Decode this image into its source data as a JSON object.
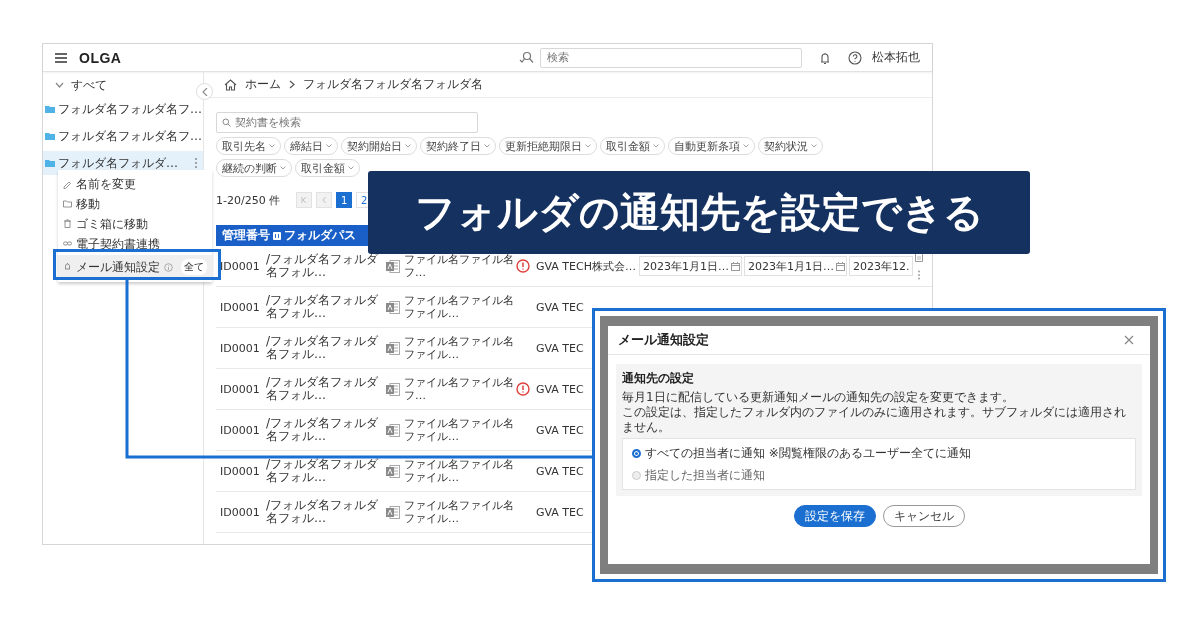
{
  "app": {
    "logo": "OLGA",
    "search_placeholder": "検索",
    "user_name": "松本拓也"
  },
  "sidebar": {
    "root": {
      "label": "すべて",
      "expanded": true
    },
    "folders": [
      {
        "label": "フォルダ名フォルダ名フ…",
        "selected": false
      },
      {
        "label": "フォルダ名フォルダ名フ…",
        "selected": false
      },
      {
        "label": "フォルダ名フォルダ…",
        "selected": true
      }
    ]
  },
  "context_menu": {
    "items": [
      {
        "kind": "rename",
        "label": "名前を変更",
        "selected": false
      },
      {
        "kind": "move",
        "label": "移動",
        "selected": false
      },
      {
        "kind": "trash",
        "label": "ゴミ箱に移動",
        "selected": false
      },
      {
        "kind": "link",
        "label": "電子契約書連携",
        "selected": false
      },
      {
        "kind": "notify",
        "label": "メール通知設定",
        "badge": "全て",
        "selected": true
      }
    ]
  },
  "breadcrumb": [
    "ホーム",
    "フォルダ名フォルダ名フォルダ名"
  ],
  "search": {
    "placeholder": "契約書を検索"
  },
  "filter_rows": [
    {
      "chips": [
        "取引先名",
        "締結日",
        "契約開始日",
        "契約終了日",
        "更新拒絶期限日",
        "取引金額",
        "自動更新条項",
        "契約状況"
      ]
    },
    {
      "chips": [
        "継続の判断",
        "取引金額"
      ]
    }
  ],
  "pagination": {
    "range": "1-20/250 件",
    "pages": [
      {
        "label": "1",
        "selected": true
      },
      {
        "label": "2",
        "selected": false
      }
    ]
  },
  "table": {
    "columns": [
      "管理番号",
      "フォルダパス"
    ],
    "rows": [
      {
        "id": "ID0001",
        "path": "/フォルダ名フォルダ名フォル…",
        "file": "ファイル名ファイル名フ…",
        "warning": true,
        "company": "GVA TECH株式会…",
        "dates": [
          "2023年1月1日…",
          "2023年1月1日…",
          "2023年12."
        ]
      },
      {
        "id": "ID0001",
        "path": "/フォルダ名フォルダ名フォル…",
        "file": "ファイル名ファイル名ファイル…",
        "warning": false,
        "company": "GVA TEC"
      },
      {
        "id": "ID0001",
        "path": "/フォルダ名フォルダ名フォル…",
        "file": "ファイル名ファイル名ファイル…",
        "warning": false,
        "company": "GVA TEC"
      },
      {
        "id": "ID0001",
        "path": "/フォルダ名フォルダ名フォル…",
        "file": "ファイル名ファイル名フ…",
        "warning": true,
        "company": "GVA TEC"
      },
      {
        "id": "ID0001",
        "path": "/フォルダ名フォルダ名フォル…",
        "file": "ファイル名ファイル名ファイル…",
        "warning": false,
        "company": "GVA TEC"
      },
      {
        "id": "ID0001",
        "path": "/フォルダ名フォルダ名フォル…",
        "file": "ファイル名ファイル名ファイル…",
        "warning": false,
        "company": "GVA TEC"
      },
      {
        "id": "ID0001",
        "path": "/フォルダ名フォルダ名フォル…",
        "file": "ファイル名ファイル名ファイル…",
        "warning": false,
        "company": "GVA TEC"
      }
    ]
  },
  "banner": {
    "text": "フォルダの通知先を設定できる"
  },
  "dialog": {
    "title": "メール通知設定",
    "section_title": "通知先の設定",
    "description": [
      "毎月1日に配信している更新通知メールの通知先の設定を変更できます。",
      "この設定は、指定したフォルダ内のファイルのみに適用されます。サブフォルダには適用されません。"
    ],
    "options": [
      {
        "label": "すべての担当者に通知 ※閲覧権限のあるユーザー全てに通知",
        "selected": true,
        "disabled": false
      },
      {
        "label": "指定した担当者に通知",
        "selected": false,
        "disabled": true
      }
    ],
    "buttons": [
      {
        "kind": "primary",
        "label": "設定を保存"
      },
      {
        "kind": "secondary",
        "label": "キャンセル"
      }
    ]
  }
}
